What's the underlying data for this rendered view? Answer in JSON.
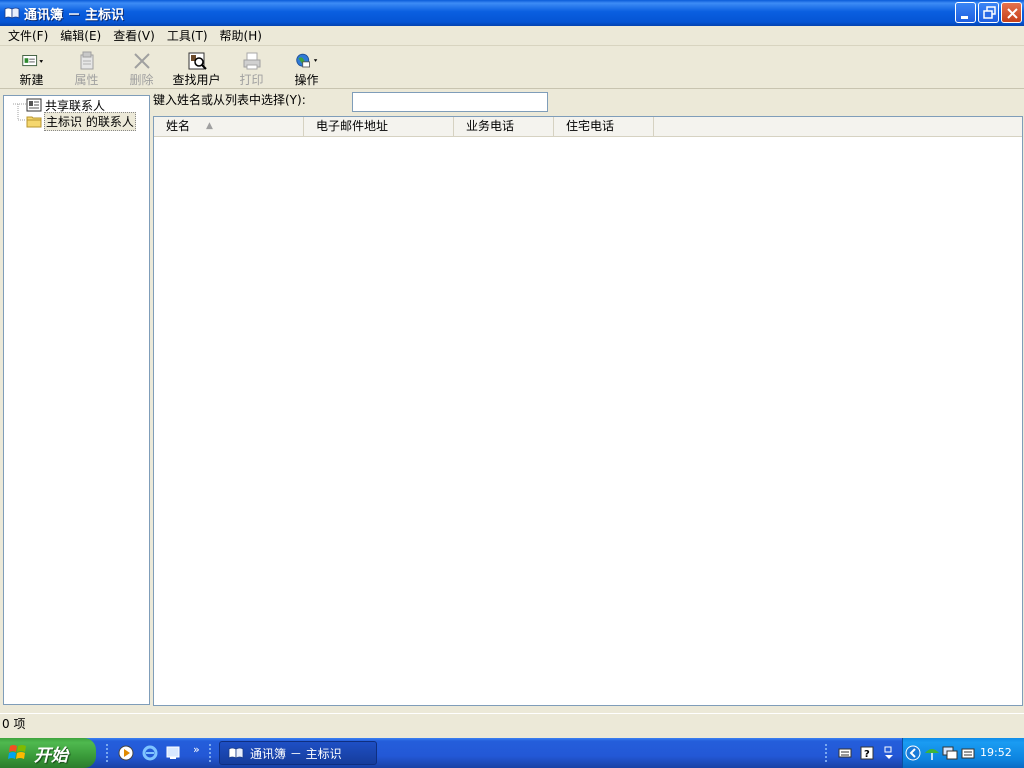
{
  "window": {
    "title": "通讯簿 － 主标识"
  },
  "menu": [
    {
      "label": "文件(F)"
    },
    {
      "label": "编辑(E)"
    },
    {
      "label": "查看(V)"
    },
    {
      "label": "工具(T)"
    },
    {
      "label": "帮助(H)"
    }
  ],
  "toolbar": [
    {
      "label": "新建",
      "icon": "new-contact-icon",
      "enabled": true
    },
    {
      "label": "属性",
      "icon": "properties-icon",
      "enabled": false
    },
    {
      "label": "删除",
      "icon": "delete-icon",
      "enabled": false
    },
    {
      "label": "查找用户",
      "icon": "find-people-icon",
      "enabled": true
    },
    {
      "label": "打印",
      "icon": "print-icon",
      "enabled": false
    },
    {
      "label": "操作",
      "icon": "action-icon",
      "enabled": true
    }
  ],
  "tree": {
    "items": [
      {
        "label": "共享联系人",
        "icon": "shared-contacts-icon"
      },
      {
        "label": "主标识 的联系人",
        "icon": "folder-icon",
        "selected": true
      }
    ]
  },
  "search": {
    "label": "键入姓名或从列表中选择(Y):",
    "value": ""
  },
  "list": {
    "columns": [
      {
        "label": "姓名",
        "sorted": true
      },
      {
        "label": "电子邮件地址"
      },
      {
        "label": "业务电话"
      },
      {
        "label": "住宅电话"
      }
    ],
    "rows": []
  },
  "status": {
    "text": "0 项"
  },
  "taskbar": {
    "start_label": "开始",
    "task_label": "通讯簿 － 主标识",
    "clock": "19:52"
  },
  "colors": {
    "titlebar": "#0a5fe0",
    "taskbar": "#245edb",
    "start": "#3a9b3a",
    "window_bg": "#ece9d8"
  }
}
